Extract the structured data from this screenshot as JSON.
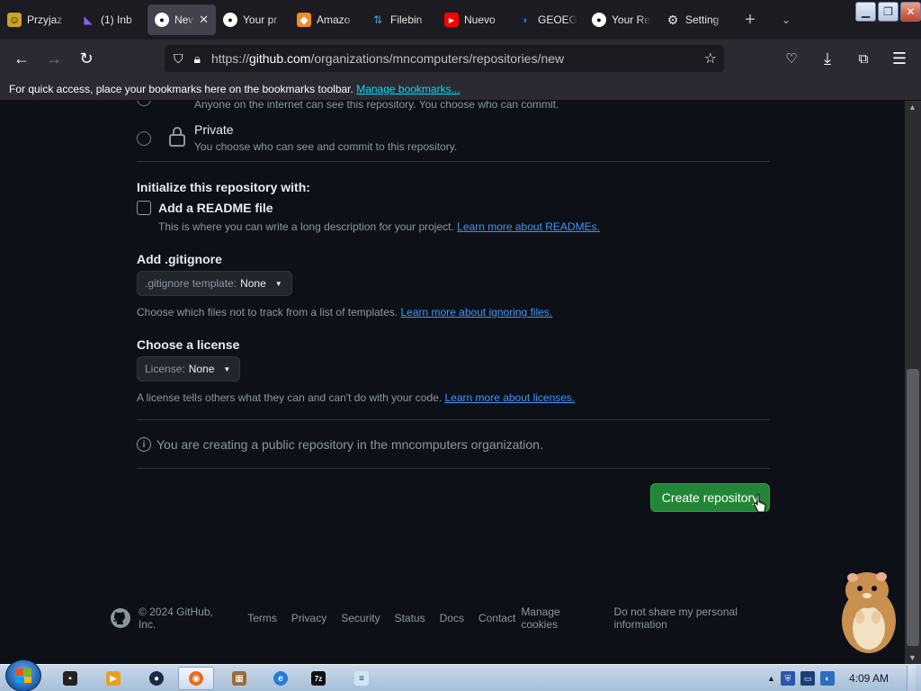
{
  "browser": {
    "tabs": [
      {
        "label": "Przyjaz",
        "icon": "site-icon",
        "color": "#c9a227"
      },
      {
        "label": "(1) Inb",
        "icon": "proton-mail-icon",
        "color": "#8b5cf6"
      },
      {
        "label": "New",
        "icon": "github-icon",
        "color": "#ffffff",
        "active": true
      },
      {
        "label": "Your pr",
        "icon": "github-icon",
        "color": "#ffffff"
      },
      {
        "label": "Amazo",
        "icon": "amazon-icon",
        "color": "#f08c24"
      },
      {
        "label": "Filebin",
        "icon": "filebin-icon",
        "color": "#4c9ad8"
      },
      {
        "label": "Nuevo",
        "icon": "youtube-icon",
        "color": "#ff0000"
      },
      {
        "label": "GEOEG",
        "icon": "geoeg-icon",
        "color": "#1a73e8"
      },
      {
        "label": "Your Re",
        "icon": "github-icon",
        "color": "#ffffff"
      },
      {
        "label": "Setting",
        "icon": "gear-icon",
        "color": "#e6e6e6"
      }
    ],
    "url_prefix": "https://",
    "url_host": "github.com",
    "url_path": "/organizations/mncomputers/repositories/new",
    "bookmarks_text": "For quick access, place your bookmarks here on the bookmarks toolbar.",
    "bookmarks_link": "Manage bookmarks..."
  },
  "form": {
    "public_desc_cut": "Anyone on the internet can see this repository. You choose who can commit.",
    "private_title": "Private",
    "private_desc": "You choose who can see and commit to this repository.",
    "init_heading": "Initialize this repository with:",
    "readme_label": "Add a README file",
    "readme_desc": "This is where you can write a long description for your project.",
    "readme_link": "Learn more about READMEs.",
    "gitignore_heading": "Add .gitignore",
    "gitignore_prefix": ".gitignore template:",
    "gitignore_value": "None",
    "gitignore_help": "Choose which files not to track from a list of templates.",
    "gitignore_link": "Learn more about ignoring files.",
    "license_heading": "Choose a license",
    "license_prefix": "License:",
    "license_value": "None",
    "license_help": "A license tells others what they can and can't do with your code.",
    "license_link": "Learn more about licenses.",
    "info_text": "You are creating a public repository in the mncomputers organization.",
    "create_button": "Create repository"
  },
  "footer": {
    "copyright": "© 2024 GitHub, Inc.",
    "links": [
      "Terms",
      "Privacy",
      "Security",
      "Status",
      "Docs",
      "Contact",
      "Manage cookies",
      "Do not share my personal information"
    ]
  },
  "taskbar": {
    "clock": "4:09 AM"
  },
  "colors": {
    "accent_green": "#238636",
    "link_blue": "#4493f8",
    "bg": "#0d1117"
  }
}
